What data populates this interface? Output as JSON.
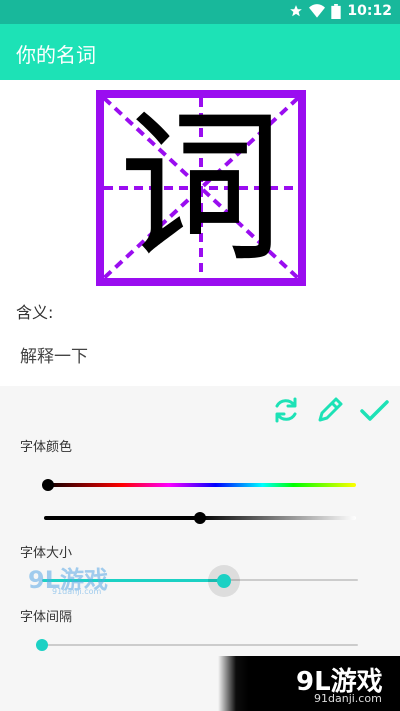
{
  "status_bar": {
    "time": "10:12",
    "icons": [
      "star-icon",
      "wifi-icon",
      "battery-icon"
    ]
  },
  "app_bar": {
    "title": "你的名词"
  },
  "character": {
    "glyph": "词"
  },
  "meaning": {
    "label": "含义:",
    "text": "解释一下"
  },
  "toolbar": {
    "icons": [
      "refresh-icon",
      "pencil-icon",
      "check-icon"
    ]
  },
  "settings": {
    "font_color_label": "字体颜色",
    "font_size_label": "字体大小",
    "font_spacing_label": "字体间隔",
    "hue_slider_level": 0.0,
    "brightness_slider_level": 0.5,
    "size_slider_level": 0.58,
    "spacing_slider_level": 0.0
  },
  "watermark": {
    "logo": "9L游戏",
    "url": "91danji.com"
  },
  "colors": {
    "accent": "#1de2b6",
    "status": "#18b89b",
    "grid": "#9a0df0",
    "slider": "#1cd1c4"
  }
}
